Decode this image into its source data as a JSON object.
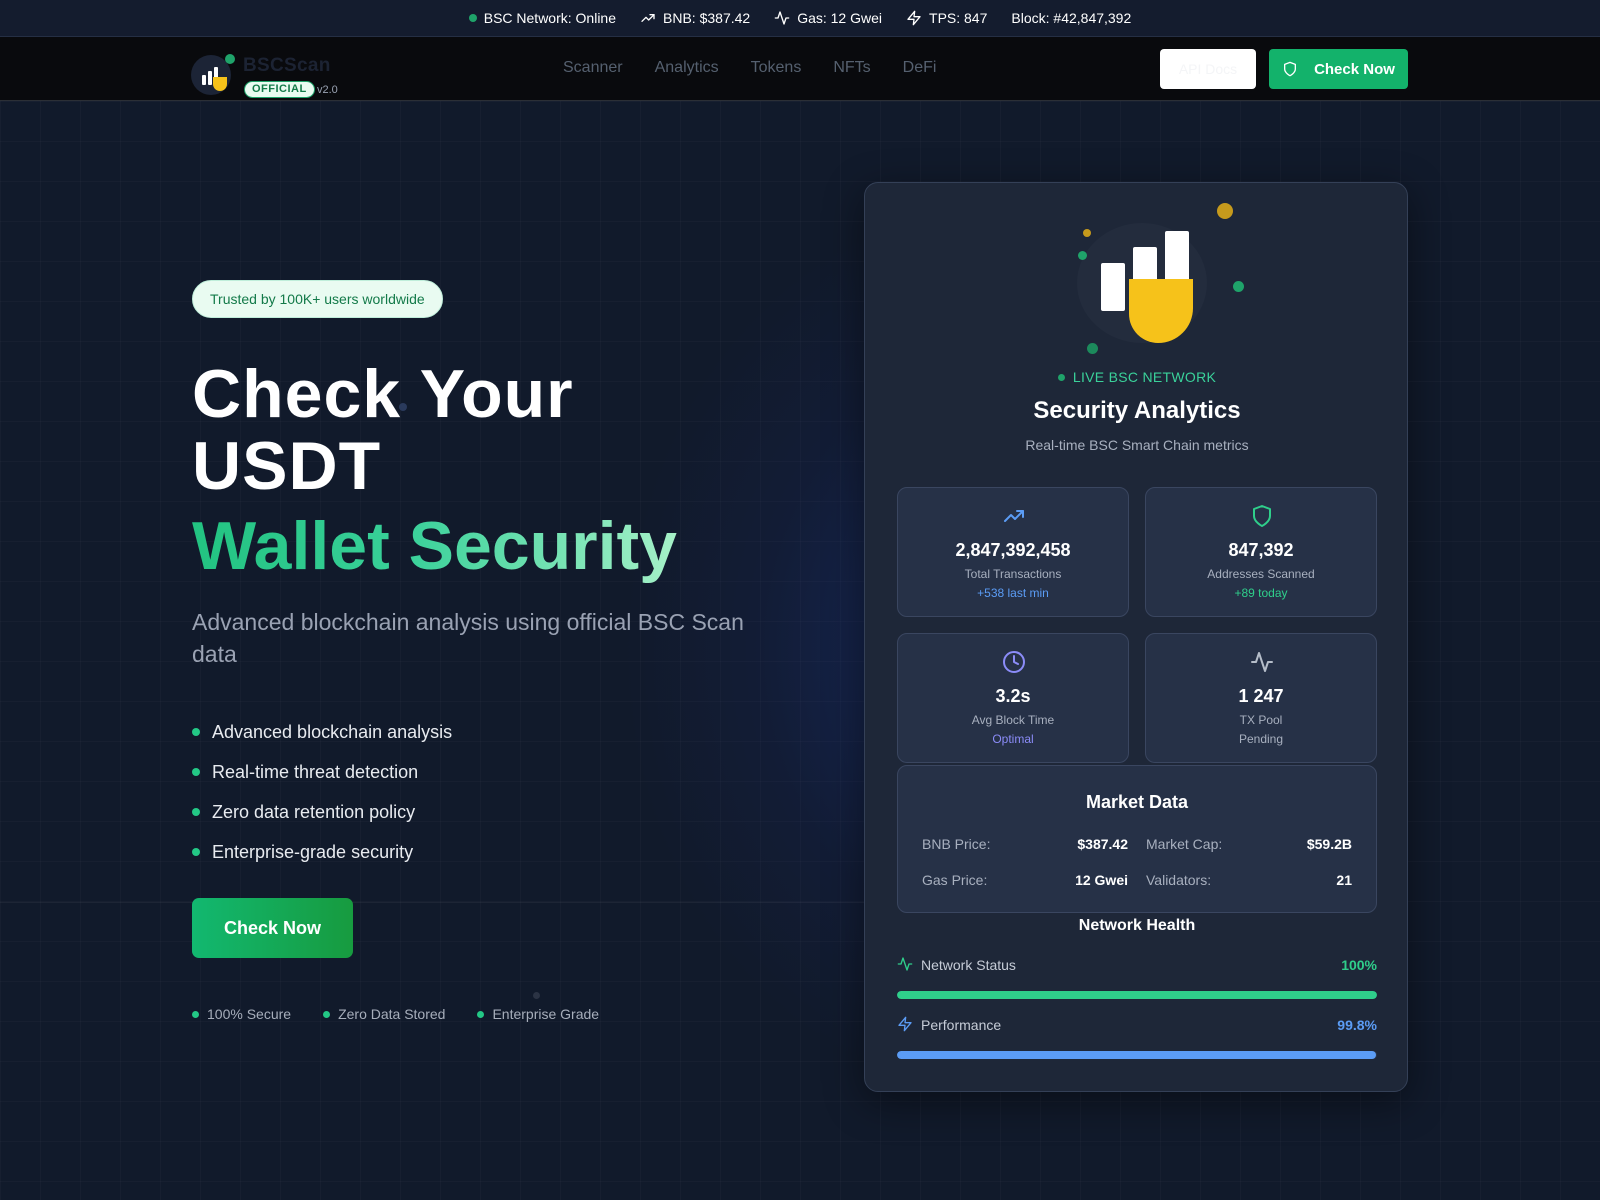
{
  "ticker": {
    "network_status": "BSC Network: Online",
    "bnb": "BNB: $387.42",
    "gas": "Gas: 12 Gwei",
    "tps": "TPS: 847",
    "block": "Block: #42,847,392"
  },
  "nav": {
    "logo_name": "BSCScan",
    "logo_badge": "OFFICIAL",
    "logo_version": "v2.0",
    "links": [
      "Scanner",
      "Analytics",
      "Tokens",
      "NFTs",
      "DeFi"
    ],
    "api_button": "API Docs",
    "check_button": "Check Now"
  },
  "hero": {
    "trust_badge": "Trusted by 100K+ users worldwide",
    "title_line1": "Check Your",
    "title_line2": "USDT",
    "title_accent": "Wallet Security",
    "subtitle": "Advanced blockchain analysis using official BSC Scan data",
    "features": [
      "Advanced blockchain analysis",
      "Real-time threat detection",
      "Zero data retention policy",
      "Enterprise-grade security"
    ],
    "cta": "Check Now",
    "trust_items": [
      "100% Secure",
      "Zero Data Stored",
      "Enterprise Grade"
    ]
  },
  "card": {
    "live_label": "LIVE BSC NETWORK",
    "title": "Security Analytics",
    "subtitle": "Real-time BSC Smart Chain metrics",
    "metrics": [
      {
        "value": "2,847,392,458",
        "label": "Total Transactions",
        "delta": "+538 last min",
        "icon": "trending-up-icon",
        "delta_color": "#5b9cf5"
      },
      {
        "value": "847,392",
        "label": "Addresses Scanned",
        "delta": "+89 today",
        "icon": "shield-icon",
        "delta_color": "#2fcf8b"
      },
      {
        "value": "3.2s",
        "label": "Avg Block Time",
        "delta": "Optimal",
        "icon": "clock-icon",
        "delta_color": "#8b8cf8"
      },
      {
        "value": "1 247",
        "label": "TX Pool",
        "delta": "Pending",
        "icon": "activity-icon",
        "delta_color": "#a8b0bf"
      }
    ],
    "market": {
      "title": "Market Data",
      "bnb_price_label": "BNB Price:",
      "bnb_price": "$387.42",
      "market_cap_label": "Market Cap:",
      "market_cap": "$59.2B",
      "gas_price_label": "Gas Price:",
      "gas_price": "12 Gwei",
      "validators_label": "Validators:",
      "validators": "21"
    },
    "health": {
      "title": "Network Health",
      "network_status_label": "Network Status",
      "network_status_value": "100%",
      "network_status_pct": 100,
      "performance_label": "Performance",
      "performance_value": "99.8%",
      "performance_pct": 99.8
    }
  },
  "colors": {
    "accent_green": "#13b26b",
    "accent_blue": "#5b9cf5",
    "brand_yellow": "#f6c21a",
    "background": "#111a2b"
  }
}
